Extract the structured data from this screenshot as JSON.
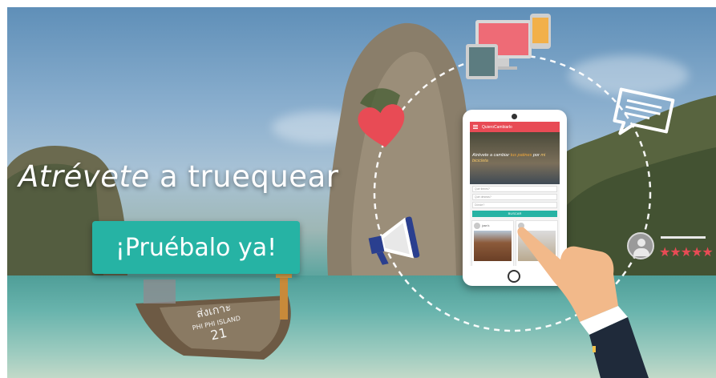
{
  "banner": {
    "headline_italic": "Atrévete",
    "headline_rest": " a truequear",
    "cta_label": "¡Pruébalo ya!",
    "boat_text_line1": "ส่งเกาะ",
    "boat_text_line2": "PHI PHI ISLAND",
    "boat_number": "21"
  },
  "phone": {
    "app_name": "QuieroCambiarlo",
    "hero_text_before": "Atrévete a cambiar ",
    "hero_highlight_1": "tus patines",
    "hero_text_mid": " por ",
    "hero_highlight_2": "mi bicicleta",
    "field_1": "Qué tienes?",
    "field_2": "Qué deseas?",
    "field_3": "Dónde?",
    "search_label": "BUSCAR",
    "card_user": "jose b."
  },
  "rating": {
    "stars": "★★★★★"
  },
  "icons": [
    "heart-icon",
    "devices-icon",
    "chat-icon",
    "megaphone-icon",
    "user-avatar-icon",
    "pointing-hand-icon"
  ],
  "colors": {
    "accent": "#26b3a4",
    "brand_red": "#e84b55"
  }
}
